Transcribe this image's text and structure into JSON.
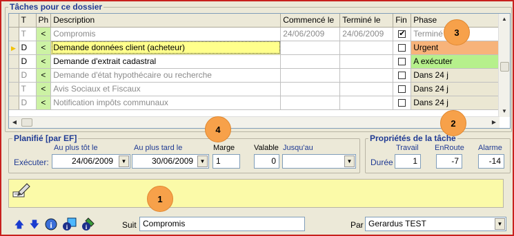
{
  "section_title": "Tâches pour ce dossier",
  "columns": {
    "t": "T",
    "ph": "Ph",
    "description": "Description",
    "commence": "Commencé le",
    "termine": "Terminé le",
    "fin": "Fin",
    "phase": "Phase"
  },
  "rows": [
    {
      "t": "T",
      "ph": "<",
      "description": "Compromis",
      "commence": "24/06/2009",
      "termine": "24/06/2009",
      "fin": true,
      "phase": "Terminé",
      "phase_color": "#ffffff",
      "gray": true
    },
    {
      "t": "D",
      "ph": "<",
      "description": "Demande données client (acheteur)",
      "commence": "",
      "termine": "",
      "fin": false,
      "phase": "Urgent",
      "phase_color": "#f7b37a",
      "gray": false,
      "current": true
    },
    {
      "t": "D",
      "ph": "<",
      "description": "Demande d'extrait cadastral",
      "commence": "",
      "termine": "",
      "fin": false,
      "phase": "A exécuter",
      "phase_color": "#b6f08c",
      "gray": false
    },
    {
      "t": "D",
      "ph": "<",
      "description": "Demande d'état hypothécaire ou recherche",
      "commence": "",
      "termine": "",
      "fin": false,
      "phase": "Dans 24 j",
      "phase_color": "#ebe7d3",
      "gray": true
    },
    {
      "t": "T",
      "ph": "<",
      "description": "Avis Sociaux et Fiscaux",
      "commence": "",
      "termine": "",
      "fin": false,
      "phase": "Dans 24 j",
      "phase_color": "#ebe7d3",
      "gray": true
    },
    {
      "t": "D",
      "ph": "<",
      "description": "Notification impôts communaux",
      "commence": "",
      "termine": "",
      "fin": false,
      "phase": "Dans 24 j",
      "phase_color": "#ebe7d3",
      "gray": true
    }
  ],
  "planifie": {
    "title": "Planifié  [par EF]",
    "au_plus_tot_label": "Au plus tôt le",
    "au_plus_tard_label": "Au plus tard le",
    "marge_label": "Marge",
    "valable_label": "Valable",
    "jusquau_label": "Jusqu'au",
    "executer_label": "Exécuter:",
    "au_plus_tot": "24/06/2009",
    "au_plus_tard": "30/06/2009",
    "marge": "1",
    "valable": "0",
    "jusquau": ""
  },
  "proprietes": {
    "title": "Propriétés de la tâche",
    "travail_label": "Travail",
    "enroute_label": "EnRoute",
    "alarme_label": "Alarme",
    "duree_label": "Durée",
    "travail": "1",
    "enroute": "-7",
    "alarme": "-14"
  },
  "badges": {
    "b1": "1",
    "b2": "2",
    "b3": "3",
    "b4": "4"
  },
  "footer": {
    "suit_label": "Suit",
    "suit_value": "Compromis",
    "par_label": "Par",
    "par_value": "Gerardus TEST"
  },
  "colors": {
    "accent": "#1f3a93",
    "border": "#c8201d",
    "note_bg": "#fbfaa8",
    "badge": "#f7a14a"
  }
}
